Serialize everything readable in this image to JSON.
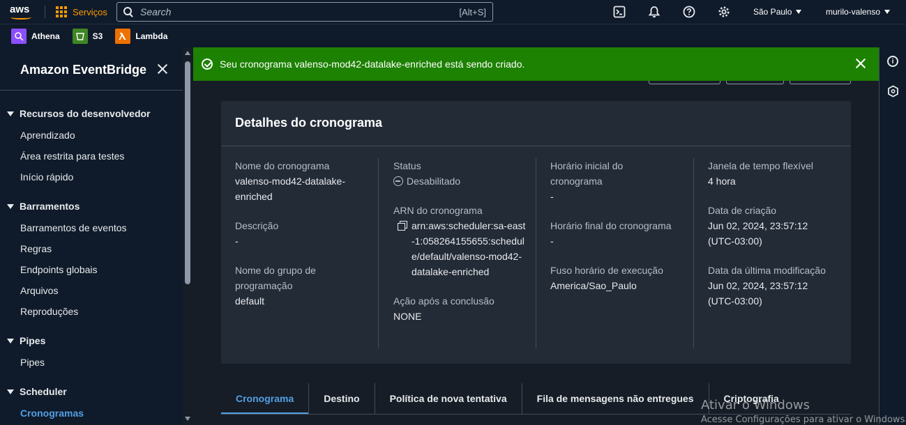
{
  "topbar": {
    "logo": "aws",
    "services_label": "Serviços",
    "search_placeholder": "Search",
    "search_shortcut": "[Alt+S]",
    "region": "São Paulo",
    "user": "murilo-valenso"
  },
  "favorites": [
    {
      "label": "Athena",
      "icon": "athena-icon",
      "color": "#8c4fff"
    },
    {
      "label": "S3",
      "icon": "s3-icon",
      "color": "#3f8624"
    },
    {
      "label": "Lambda",
      "icon": "lambda-icon",
      "color": "#ed7100"
    }
  ],
  "sidebar": {
    "title": "Amazon EventBridge",
    "sections": [
      {
        "label": "Recursos do desenvolvedor",
        "items": [
          "Aprendizado",
          "Área restrita para testes",
          "Início rápido"
        ]
      },
      {
        "label": "Barramentos",
        "items": [
          "Barramentos de eventos",
          "Regras",
          "Endpoints globais",
          "Arquivos",
          "Reproduções"
        ]
      },
      {
        "label": "Pipes",
        "items": [
          "Pipes"
        ]
      },
      {
        "label": "Scheduler",
        "items": [
          "Cronogramas"
        ]
      }
    ]
  },
  "flash": {
    "message": "Seu cronograma valenso-mod42-datalake-enriched está sendo criado."
  },
  "details": {
    "title": "Detalhes do cronograma",
    "col1": {
      "name_label": "Nome do cronograma",
      "name_value": "valenso-mod42-datalake-enriched",
      "desc_label": "Descrição",
      "desc_value": "-",
      "group_label": "Nome do grupo de programação",
      "group_value": "default"
    },
    "col2": {
      "status_label": "Status",
      "status_value": "Desabilitado",
      "arn_label": "ARN do cronograma",
      "arn_value": "arn:aws:scheduler:sa-east-1:058264155655:schedule/default/valenso-mod42-datalake-enriched",
      "action_label": "Ação após a conclusão",
      "action_value": "NONE"
    },
    "col3": {
      "start_label": "Horário inicial do cronograma",
      "start_value": "-",
      "end_label": "Horário final do cronograma",
      "end_value": "-",
      "tz_label": "Fuso horário de execução",
      "tz_value": "America/Sao_Paulo"
    },
    "col4": {
      "window_label": "Janela de tempo flexível",
      "window_value": "4 hora",
      "created_label": "Data de criação",
      "created_value": "Jun 02, 2024, 23:57:12 (UTC-03:00)",
      "modified_label": "Data da última modificação",
      "modified_value": "Jun 02, 2024, 23:57:12 (UTC-03:00)"
    }
  },
  "tabs": [
    "Cronograma",
    "Destino",
    "Política de nova tentativa",
    "Fila de mensagens não entregues",
    "Criptografia"
  ],
  "watermark": {
    "line1": "Ativar o Windows",
    "line2": "Acesse Configurações para ativar o Windows."
  }
}
